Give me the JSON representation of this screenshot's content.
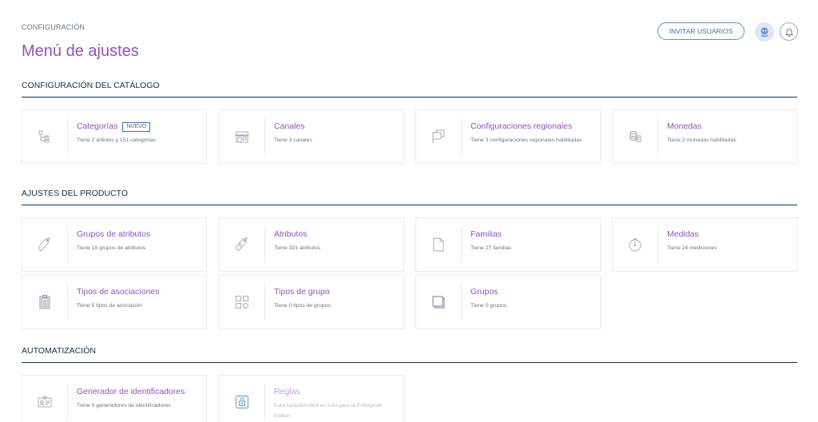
{
  "breadcrumb": "CONFIGURACIÓN",
  "page_title": "Menú de ajustes",
  "header": {
    "invite_label": "INVITAR USUARIOS",
    "avatar_icon": "user-avatar-icon",
    "bell_icon": "bell-icon"
  },
  "sections": [
    {
      "title": "CONFIGURACIÓN DEL CATÁLOGO",
      "tiles": [
        {
          "title": "Categorías",
          "badge": "NUEVO",
          "desc": "Tiene 2 árboles y 151 categorías",
          "icon": "category-tree-icon"
        },
        {
          "title": "Canales",
          "desc": "Tiene 3 canales",
          "icon": "store-icon"
        },
        {
          "title": "Configuraciones regionales",
          "desc": "Tiene 3 configuraciones regionales habilitadas",
          "icon": "flag-icon"
        },
        {
          "title": "Monedas",
          "desc": "Tiene 2 monedas habilitadas",
          "icon": "coins-icon"
        }
      ]
    },
    {
      "title": "AJUSTES DEL PRODUCTO",
      "tiles": [
        {
          "title": "Grupos de atributos",
          "desc": "Tiene 18 grupos de atributos",
          "icon": "tag-icon"
        },
        {
          "title": "Atributos",
          "desc": "Tiene 331 atributos",
          "icon": "tag-lines-icon"
        },
        {
          "title": "Familias",
          "desc": "Tiene 27 familias",
          "icon": "document-icon"
        },
        {
          "title": "Medidas",
          "desc": "Tiene 24 mediciones",
          "icon": "gauge-icon"
        },
        {
          "title": "Tipos de asociaciones",
          "desc": "Tiene 5 tipos de asociación",
          "icon": "clipboard-icon"
        },
        {
          "title": "Tipos de grupo",
          "desc": "Tiene 0 tipos de grupos",
          "icon": "grid-icon"
        },
        {
          "title": "Grupos",
          "desc": "Tiene 0 grupos",
          "icon": "stacked-squares-icon"
        }
      ]
    },
    {
      "title": "AUTOMATIZACIÓN",
      "tiles": [
        {
          "title": "Generador de identificadores",
          "desc": "Tiene 0 generadores de identificadores",
          "icon": "id-card-icon"
        },
        {
          "title": "Reglas",
          "desc": "Esta característica es solo para la Enterprise Edition",
          "icon": "lock-icon",
          "disabled": true
        }
      ]
    }
  ],
  "colors": {
    "accent": "#9452ba",
    "text": "#11324d",
    "muted": "#67768a",
    "border": "#e8ebee",
    "button_border": "#5992c7"
  }
}
